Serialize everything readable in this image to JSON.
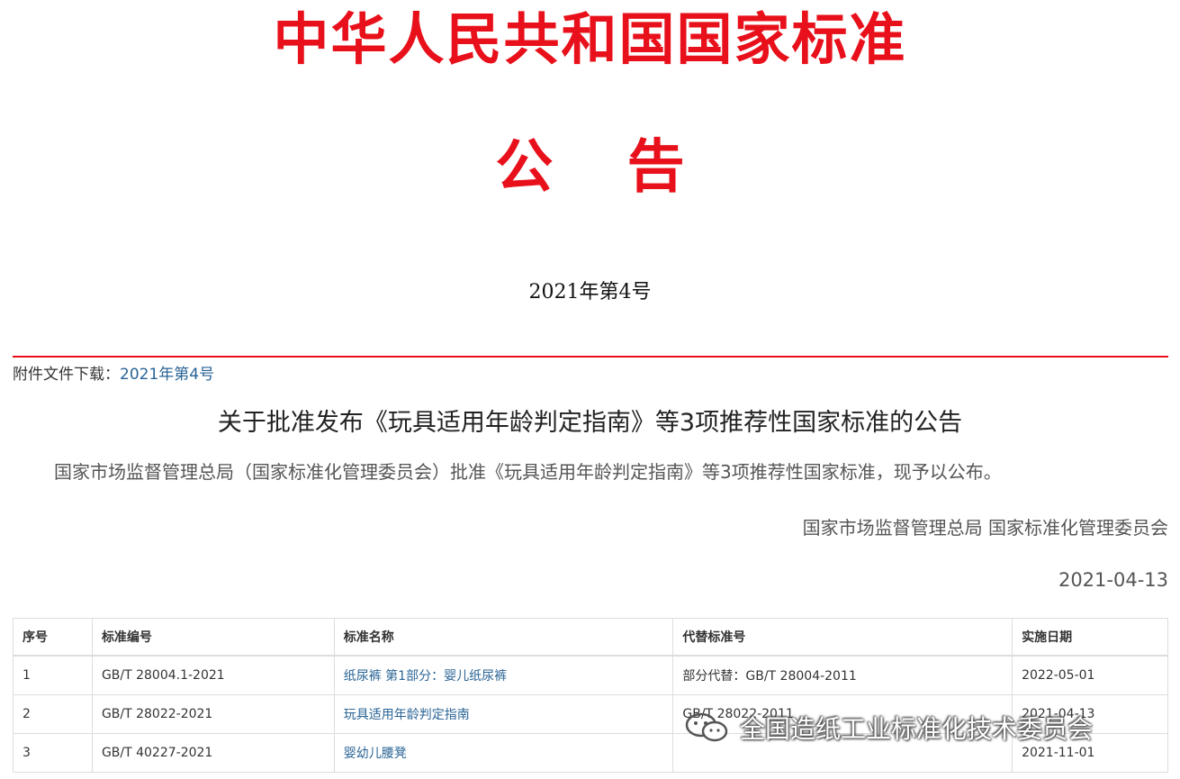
{
  "masthead": "中华人民共和国国家标准",
  "notice_word": "公 告",
  "issue_number": "2021年第4号",
  "attachment": {
    "label": "附件文件下载：",
    "link_text": "2021年第4号"
  },
  "title": "关于批准发布《玩具适用年龄判定指南》等3项推荐性国家标准的公告",
  "body": "国家市场监督管理总局（国家标准化管理委员会）批准《玩具适用年龄判定指南》等3项推荐性国家标准，现予以公布。",
  "signer": "国家市场监督管理总局 国家标准化管理委员会",
  "date": "2021-04-13",
  "table": {
    "headers": [
      "序号",
      "标准编号",
      "标准名称",
      "代替标准号",
      "实施日期"
    ],
    "rows": [
      {
        "no": "1",
        "code": "GB/T 28004.1-2021",
        "name": "纸尿裤 第1部分：婴儿纸尿裤",
        "replaces": "部分代替：GB/T 28004-2011",
        "date": "2022-05-01"
      },
      {
        "no": "2",
        "code": "GB/T 28022-2021",
        "name": "玩具适用年龄判定指南",
        "replaces": "GB/T 28022-2011",
        "date": "2021-04-13"
      },
      {
        "no": "3",
        "code": "GB/T 40227-2021",
        "name": "婴幼儿腰凳",
        "replaces": "",
        "date": "2021-11-01"
      }
    ]
  },
  "watermark": {
    "text": "全国造纸工业标准化技术委员会",
    "icon": "wechat-icon"
  },
  "colors": {
    "red": "#e8101a",
    "link": "#2a6496"
  }
}
